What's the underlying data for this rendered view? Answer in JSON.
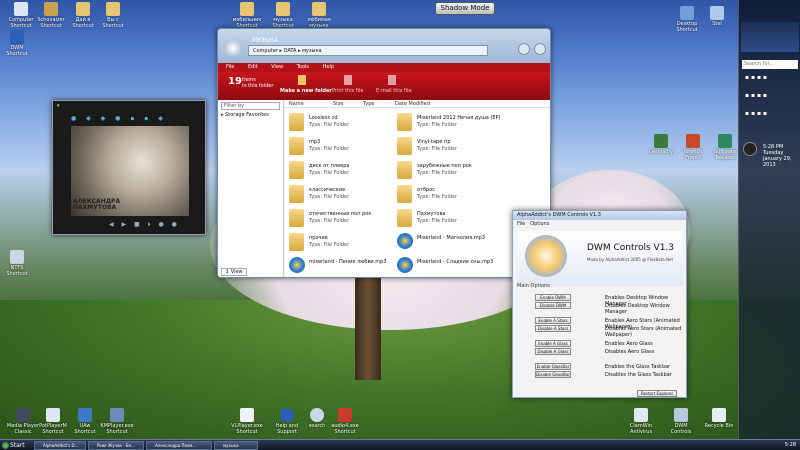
{
  "desktop": {
    "top_icons": [
      {
        "label": "Computer\nShortcut"
      },
      {
        "label": "Schovaizer\nShortcut"
      },
      {
        "label": "Дай в\nShortcut"
      },
      {
        "label": "Вы с\nShortcut"
      },
      {
        "label": "мобильник\nShortcut"
      },
      {
        "label": "музыка\nShortcut"
      },
      {
        "label": "любимая музыка\nShortcut"
      }
    ],
    "right_top_icons": [
      {
        "label": "Desktop\nShortcut"
      },
      {
        "label": "Stel"
      }
    ],
    "left_icons": [
      {
        "label": "DWM\nShortcut"
      },
      {
        "label": "NTFS\nShortcut"
      }
    ],
    "bottom_icons": [
      {
        "label": "Media Player\nClassic"
      },
      {
        "label": "PotPlayerM\nShortcut"
      },
      {
        "label": "UAw\nShortcut"
      },
      {
        "label": "KMPlayer.exe\nShortcut"
      },
      {
        "label": "VLPlayer.exe\nShortcut"
      },
      {
        "label": "Help and\nSupport"
      },
      {
        "label": "search"
      },
      {
        "label": "audio4.exe\nShortcut"
      },
      {
        "label": "ClamWin\nAntivirus"
      },
      {
        "label": "DWM\nControls"
      },
      {
        "label": "Recycle Bin"
      }
    ],
    "right_mid_icons": [
      {
        "label": "Gennadiy"
      },
      {
        "label": "Wrench\nFriend"
      },
      {
        "label": "Software\nTweaker"
      }
    ]
  },
  "shadow_mode": "Shadow Mode",
  "sidebar": {
    "search_placeholder": "Search for...",
    "clock_time": "5:28 PM",
    "clock_day": "Tuesday",
    "clock_date": "January 29, 2013"
  },
  "explorer": {
    "crumb_root": "МУЗЫКА",
    "crumb_parts": [
      "Computer",
      "DATA",
      "музыка"
    ],
    "menu": [
      "File",
      "Edit",
      "View",
      "Tools",
      "Help"
    ],
    "items_count": "19",
    "items_text": "items\nin this folder",
    "cmd_new_folder": "Make a new folder",
    "cmd_print": "Print this file",
    "cmd_email": "E-mail this file",
    "filter_placeholder": "Filter by",
    "storage_favorites": "Storage Favorites",
    "view_button": "View",
    "columns": [
      "Name",
      "Size",
      "Type",
      "Date Modified"
    ],
    "type_folder": "Type: File Folder",
    "files_left": [
      {
        "name": "Loosless cd",
        "type": "Type: File Folder",
        "kind": "folder"
      },
      {
        "name": "mp3",
        "type": "Type: File Folder",
        "kind": "folder"
      },
      {
        "name": "диск от плеера",
        "type": "Type: File Folder",
        "kind": "folder"
      },
      {
        "name": "классические",
        "type": "Type: File Folder",
        "kind": "folder"
      },
      {
        "name": "отечественные поп рок",
        "type": "Type: File Folder",
        "kind": "folder"
      },
      {
        "name": "прочие",
        "type": "Type: File Folder",
        "kind": "folder"
      },
      {
        "name": "mixerland - Пение любви.mp3",
        "type": "",
        "kind": "mp3"
      }
    ],
    "files_right": [
      {
        "name": "Mixerland 2012 Нечая душа (EP)",
        "type": "Type: File Folder",
        "kind": "folder"
      },
      {
        "name": "Vinyl-tape rip",
        "type": "Type: File Folder",
        "kind": "folder"
      },
      {
        "name": "зарубежные поп рок",
        "type": "Type: File Folder",
        "kind": "folder"
      },
      {
        "name": "отброс",
        "type": "Type: File Folder",
        "kind": "folder"
      },
      {
        "name": "Пахмутова",
        "type": "Type: File Folder",
        "kind": "folder"
      },
      {
        "name": "Mixerland - Магнолия.mp3",
        "type": "",
        "kind": "mp3"
      },
      {
        "name": "Mixerland - Сладкие сны.mp3",
        "type": "",
        "kind": "mp3"
      }
    ]
  },
  "player": {
    "caption_line1": "АЛЕКСАНДРА",
    "caption_line2": "ПАХМУТОВА"
  },
  "dwm": {
    "title": "AlphaAddict's DWM Controls V1.3",
    "menu": [
      "File",
      "Options"
    ],
    "heading": "DWM Controls V1.3",
    "subheading": "Made by AlphaAddict 2005 @ FlexBeta.Net",
    "main_options": "Main Options",
    "buttons": [
      {
        "label": "Enable DWM",
        "desc": "Enables Desktop Window Manager"
      },
      {
        "label": "Disable DWM",
        "desc": "Disables Desktop Window Manager"
      },
      {
        "label": "Enable A Stars",
        "desc": "Enables Aero Stars (Animated Wallpaper)"
      },
      {
        "label": "Disable A Stars",
        "desc": "Disables Aero Stars (Animated Wallpaper)"
      },
      {
        "label": "Enable A Glass",
        "desc": "Enables Aero Glass"
      },
      {
        "label": "Disable A Glass",
        "desc": "Disables Aero Glass"
      },
      {
        "label": "Enable GlassBar",
        "desc": "Enables the Glass Taskbar"
      },
      {
        "label": "Disable GlassBar",
        "desc": "Disables the Glass Taskbar"
      }
    ],
    "restart": "Restart Explorer"
  },
  "taskbar": {
    "start": "Start",
    "buttons": [
      "AlphaAddict's D...",
      "Powr Жучок - Бе...",
      "Александра Пахм...",
      "музыка"
    ],
    "tray_time": "5:28"
  }
}
